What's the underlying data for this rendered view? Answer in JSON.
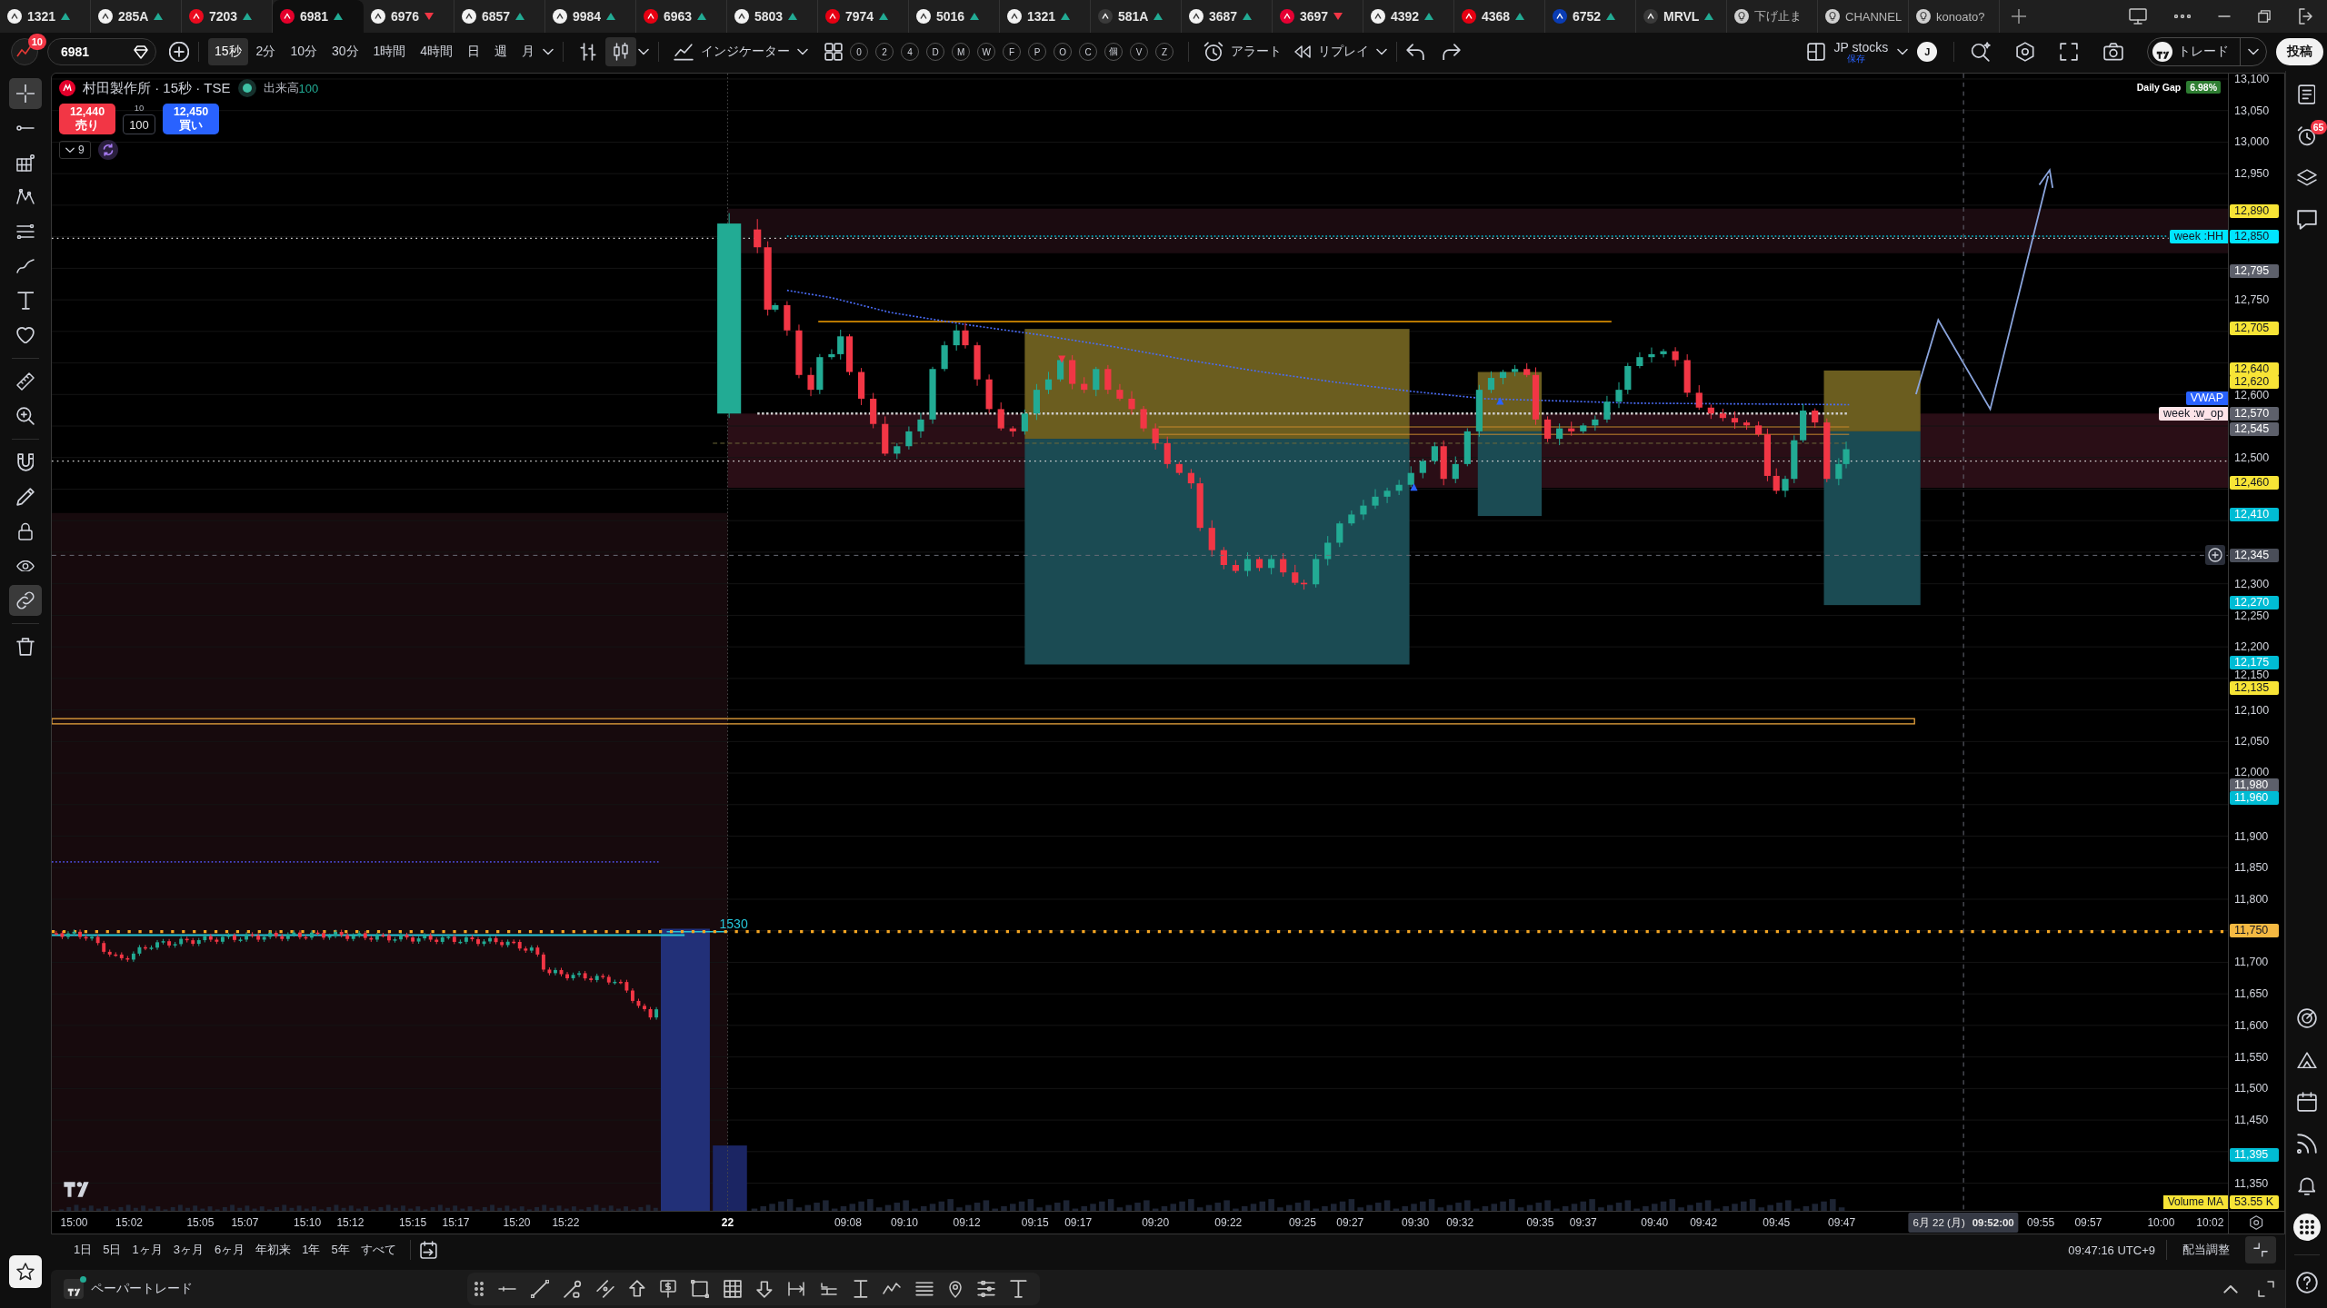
{
  "tabs": [
    {
      "kind": "symbol",
      "label": "1321",
      "up": true,
      "color": "#f2f2f2",
      "selected": false
    },
    {
      "kind": "symbol",
      "label": "285A",
      "up": true,
      "color": "#f2f2f2",
      "selected": false
    },
    {
      "kind": "symbol",
      "label": "7203",
      "up": true,
      "color": "#eb0a1e",
      "selected": false
    },
    {
      "kind": "symbol",
      "label": "6981",
      "up": true,
      "color": "#e4002b",
      "selected": true
    },
    {
      "kind": "symbol",
      "label": "6976",
      "up": false,
      "color": "#f2f2f2",
      "selected": false
    },
    {
      "kind": "symbol",
      "label": "6857",
      "up": true,
      "color": "#f2f2f2",
      "selected": false
    },
    {
      "kind": "symbol",
      "label": "9984",
      "up": true,
      "color": "#f2f2f2",
      "selected": false
    },
    {
      "kind": "symbol",
      "label": "6963",
      "up": true,
      "color": "#e60012",
      "selected": false
    },
    {
      "kind": "symbol",
      "label": "5803",
      "up": true,
      "color": "#f2f2f2",
      "selected": false
    },
    {
      "kind": "symbol",
      "label": "7974",
      "up": true,
      "color": "#e60012",
      "selected": false
    },
    {
      "kind": "symbol",
      "label": "5016",
      "up": true,
      "color": "#f2f2f2",
      "selected": false
    },
    {
      "kind": "symbol",
      "label": "1321",
      "up": true,
      "color": "#f2f2f2",
      "selected": false
    },
    {
      "kind": "symbol",
      "label": "581A",
      "up": true,
      "color": "#3a3a3a",
      "selected": false
    },
    {
      "kind": "symbol",
      "label": "3687",
      "up": true,
      "color": "#f2f2f2",
      "selected": false
    },
    {
      "kind": "symbol",
      "label": "3697",
      "up": false,
      "color": "#e60033",
      "selected": false
    },
    {
      "kind": "symbol",
      "label": "4392",
      "up": true,
      "color": "#f2f2f2",
      "selected": false
    },
    {
      "kind": "symbol",
      "label": "4368",
      "up": true,
      "color": "#e60012",
      "selected": false
    },
    {
      "kind": "symbol",
      "label": "6752",
      "up": true,
      "color": "#0a3cb4",
      "selected": false
    },
    {
      "kind": "symbol",
      "label": "MRVL",
      "up": true,
      "color": "#3a3a3a",
      "selected": false
    },
    {
      "kind": "page",
      "label": "下げ止ま",
      "color": "#d0d0d0",
      "selected": false
    },
    {
      "kind": "page",
      "label": "CHANNEL",
      "color": "#d0d0d0",
      "selected": false
    },
    {
      "kind": "page",
      "label": "konoato?",
      "color": "#d0d0d0",
      "selected": false
    }
  ],
  "toolbar": {
    "notification_count": "10",
    "symbol": "6981",
    "intervals": [
      {
        "label": "15秒",
        "selected": true
      },
      {
        "label": "2分",
        "selected": false
      },
      {
        "label": "10分",
        "selected": false
      },
      {
        "label": "30分",
        "selected": false
      },
      {
        "label": "1時間",
        "selected": false
      },
      {
        "label": "4時間",
        "selected": false
      },
      {
        "label": "日",
        "selected": false
      },
      {
        "label": "週",
        "selected": false
      },
      {
        "label": "月",
        "selected": false
      }
    ],
    "chart_types": [
      {
        "selected": false
      },
      {
        "selected": true
      }
    ],
    "indicators": "インジケーター",
    "quick_buttons": [
      "0",
      "2",
      "4",
      "D",
      "M",
      "W",
      "F",
      "P",
      "O",
      "C",
      "個",
      "V",
      "Z"
    ],
    "alert": "アラート",
    "replay": "リプレイ",
    "layout_name": "JP stocks",
    "layout_status": "保存",
    "user_initial": "J",
    "trade": "トレード",
    "publish": "投稿"
  },
  "left_toolbar": {
    "tools": [
      {
        "active": true
      },
      {
        "active": false
      },
      {
        "active": false
      },
      {
        "active": false
      },
      {
        "active": false
      },
      {
        "active": false
      },
      {
        "active": false
      },
      {
        "active": false
      },
      {
        "active": false
      },
      {
        "active": false
      },
      {
        "active": false
      },
      {
        "active": false
      },
      {
        "active": false
      },
      {
        "active": false
      },
      {
        "active": true
      },
      {
        "active": false
      }
    ]
  },
  "chart": {
    "legend": {
      "title": "村田製作所 · 15秒 · TSE",
      "market_open": true,
      "volume_label": "出来高",
      "volume_value": "100"
    },
    "order_panel": {
      "sell": {
        "price": "12,440",
        "label": "売り"
      },
      "quantity": {
        "step": "10",
        "value": "100"
      },
      "buy": {
        "price": "12,450",
        "label": "買い"
      }
    },
    "indicator_count": "9",
    "daily_gap": {
      "label": "Daily Gap",
      "value": "6.98%"
    },
    "close_marker": "1530",
    "axis_tags": [
      {
        "text": "week :HH",
        "color": "#00e5ff"
      },
      {
        "text": "VWAP",
        "color": "#2962ff"
      },
      {
        "text": "week :w_op",
        "color": "#fde4e8"
      }
    ],
    "price_axis": {
      "ticks": [
        "13,100",
        "13,050",
        "13,000",
        "12,950",
        "12,750",
        "12,600",
        "12,500",
        "12,300",
        "12,250",
        "12,200",
        "12,150",
        "12,100",
        "12,050",
        "12,000",
        "11,900",
        "11,850",
        "11,800",
        "11,700",
        "11,650",
        "11,600",
        "11,550",
        "11,500",
        "11,450",
        "11,350"
      ],
      "badges": [
        {
          "text": "12,890",
          "color": "#f7e436"
        },
        {
          "text": "12,850",
          "color": "#00e5ff"
        },
        {
          "text": "12,795",
          "color": "#5d606b"
        },
        {
          "text": "12,705",
          "color": "#f7e436"
        },
        {
          "text": "12,640",
          "color": "#f7e436"
        },
        {
          "text": "12,620",
          "color": "#f7e436"
        },
        {
          "text": "12,570",
          "color": "#5d606b"
        },
        {
          "text": "12,545",
          "color": "#5d606b"
        },
        {
          "text": "12,460",
          "color": "#f7e436"
        },
        {
          "text": "12,410",
          "color": "#00bcd4"
        },
        {
          "text": "12,270",
          "color": "#00bcd4"
        },
        {
          "text": "12,175",
          "color": "#00bcd4"
        },
        {
          "text": "12,135",
          "color": "#f7e436"
        },
        {
          "text": "11,980",
          "color": "#5d606b"
        },
        {
          "text": "11,960",
          "color": "#00bcd4"
        },
        {
          "text": "11,750",
          "color": "#f5b942"
        },
        {
          "text": "11,395",
          "color": "#00bcd4"
        }
      ]
    },
    "crosshair": {
      "price": "12,345",
      "date": "6月 22 (月)",
      "time": "09:52:00"
    },
    "volume_ma": {
      "label": "Volume MA",
      "value": "53.55 K"
    },
    "time_axis": [
      {
        "text": "15:00",
        "kind": "time"
      },
      {
        "text": "15:02",
        "kind": "time"
      },
      {
        "text": "15:05",
        "kind": "time"
      },
      {
        "text": "15:07",
        "kind": "time"
      },
      {
        "text": "15:10",
        "kind": "time"
      },
      {
        "text": "15:12",
        "kind": "time"
      },
      {
        "text": "15:15",
        "kind": "time"
      },
      {
        "text": "15:17",
        "kind": "time"
      },
      {
        "text": "15:20",
        "kind": "time"
      },
      {
        "text": "15:22",
        "kind": "time"
      },
      {
        "text": "22",
        "kind": "day"
      },
      {
        "text": "09:08",
        "kind": "time"
      },
      {
        "text": "09:10",
        "kind": "time"
      },
      {
        "text": "09:12",
        "kind": "time"
      },
      {
        "text": "09:15",
        "kind": "time"
      },
      {
        "text": "09:17",
        "kind": "time"
      },
      {
        "text": "09:20",
        "kind": "time"
      },
      {
        "text": "09:22",
        "kind": "time"
      },
      {
        "text": "09:25",
        "kind": "time"
      },
      {
        "text": "09:27",
        "kind": "time"
      },
      {
        "text": "09:30",
        "kind": "time"
      },
      {
        "text": "09:32",
        "kind": "time"
      },
      {
        "text": "09:35",
        "kind": "time"
      },
      {
        "text": "09:37",
        "kind": "time"
      },
      {
        "text": "09:40",
        "kind": "time"
      },
      {
        "text": "09:42",
        "kind": "time"
      },
      {
        "text": "09:45",
        "kind": "time"
      },
      {
        "text": "09:47",
        "kind": "time"
      },
      {
        "text": "09:55",
        "kind": "time"
      },
      {
        "text": "09:57",
        "kind": "time"
      },
      {
        "text": "10:00",
        "kind": "time"
      },
      {
        "text": "10:02",
        "kind": "time"
      }
    ]
  },
  "range_bar": {
    "ranges": [
      "1日",
      "5日",
      "1ヶ月",
      "3ヶ月",
      "6ヶ月",
      "年初来",
      "1年",
      "5年",
      "すべて"
    ],
    "clock": "09:47:16 UTC+9",
    "adjustment": "配当調整"
  },
  "bottom_panel": {
    "title": "ペーパートレード"
  },
  "right_sidebar": {
    "alert_count": "65"
  }
}
